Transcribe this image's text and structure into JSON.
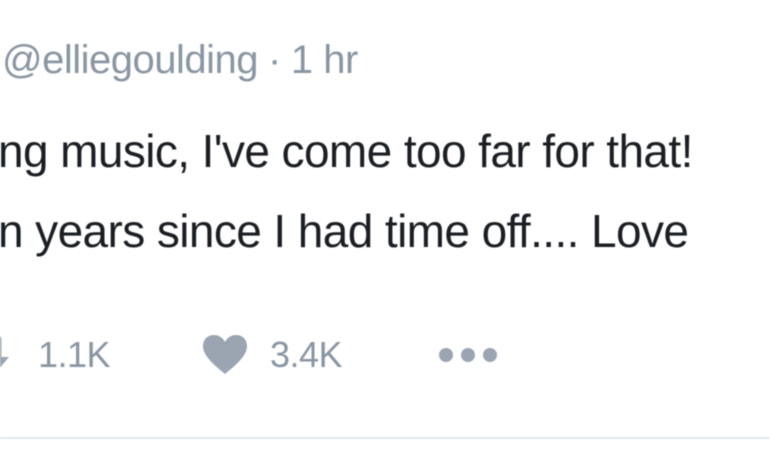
{
  "tweet": {
    "handle": "@elliegoulding",
    "separator": "·",
    "time": "1 hr",
    "lines": [
      "ng music, I've come too far for that!",
      "n years since I had time off.... Love"
    ],
    "actions": {
      "retweet_count": "1.1K",
      "like_count": "3.4K"
    }
  },
  "colors": {
    "text": "#1b1f24",
    "muted": "#8a96a3",
    "divider": "#e1e8ed",
    "icon": "#9aa5b1"
  },
  "icons": [
    "retweet-icon",
    "heart-icon",
    "more-icon"
  ]
}
